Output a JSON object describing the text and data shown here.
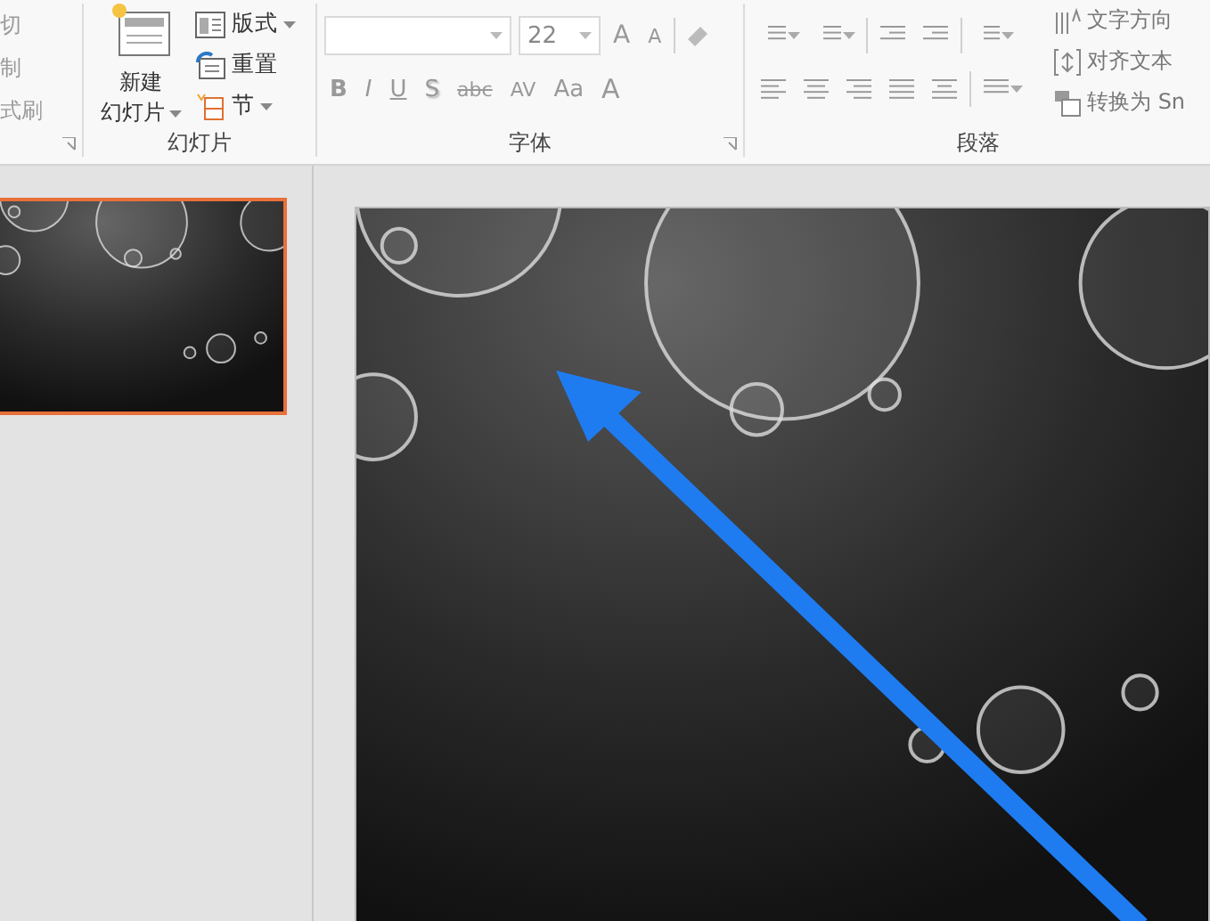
{
  "clipboard": {
    "items": [
      "切",
      "制",
      "式刷"
    ]
  },
  "slides_group": {
    "label": "幻灯片",
    "new_slide": {
      "line1": "新建",
      "line2": "幻灯片"
    },
    "items": [
      {
        "kind": "layout",
        "label": "版式",
        "dropdown": true
      },
      {
        "kind": "reset",
        "label": "重置",
        "dropdown": false
      },
      {
        "kind": "section",
        "label": "节",
        "dropdown": true
      }
    ]
  },
  "font_group": {
    "label": "字体",
    "font_size": "22",
    "grow_buttons": [
      "A",
      "A"
    ],
    "format_buttons": [
      {
        "kind": "bold",
        "label": "B"
      },
      {
        "kind": "italic",
        "label": "I"
      },
      {
        "kind": "underline",
        "label": "U"
      },
      {
        "kind": "shadow",
        "label": "S"
      },
      {
        "kind": "strike",
        "label": "abc"
      },
      {
        "kind": "spacing",
        "label": "AV"
      },
      {
        "kind": "case",
        "label": "Aa"
      },
      {
        "kind": "color",
        "label": "A"
      }
    ]
  },
  "paragraph_group": {
    "label": "段落"
  },
  "text_tools": [
    {
      "kind": "direction",
      "label": "文字方向"
    },
    {
      "kind": "align",
      "label": "对齐文本"
    },
    {
      "kind": "smartart",
      "label": "转换为 Sn"
    }
  ],
  "thumbnails": [
    {
      "kind": "picture",
      "selected": true
    }
  ],
  "slide": {
    "kind": "picture"
  }
}
